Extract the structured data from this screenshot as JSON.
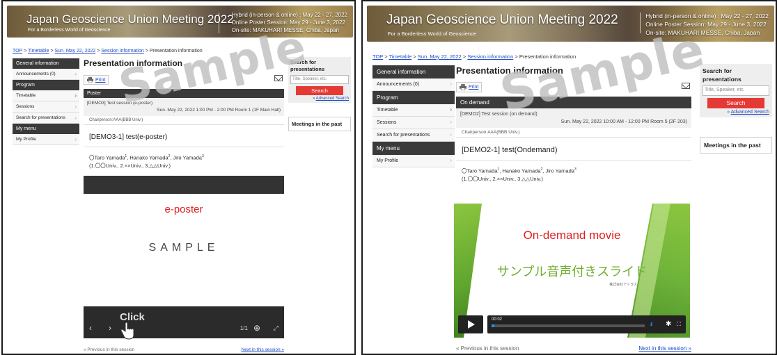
{
  "banner": {
    "title": "Japan Geoscience Union Meeting 2022",
    "tagline": "For a Borderless World of Geoscience",
    "info_line1": "Hybrid (in-person & online) : May 22 - 27, 2022",
    "info_line2": "Online Poster Session: May 29 - June 3, 2022",
    "info_line3": "On-site: MAKUHARI MESSE, Chiba, Japan"
  },
  "breadcrumb": {
    "top": "TOP",
    "timetable": "Timetable",
    "date": "Sun. May 22, 2022",
    "session_info": "Session information",
    "current": "Presentation information",
    "sep": ">"
  },
  "sidebar": {
    "general_info": "General information",
    "announcements": "Announcements (0)",
    "program": "Program",
    "timetable": "Timetable",
    "sessions": "Sessions",
    "search_presentations": "Search for presentations",
    "my_menu": "My menu",
    "my_profile": "My Profile",
    "chevron": "›"
  },
  "main": {
    "page_title": "Presentation information",
    "print": "Print"
  },
  "left": {
    "section": "Poster",
    "session": "[DEMO3] Test session (e-poster)",
    "datetime": "Sun. May 22, 2022 1:00 PM - 2:00 PM Room 1 (1F Main Hall)",
    "chair": "Chairperson:AAA(BBB Univ.)",
    "abstract_title": "[DEMO3-1] test(e-poster)",
    "viewer_title": "e-poster",
    "viewer_sample": "SAMPLE",
    "click_label": "Click",
    "page_indicator": "1/1",
    "prev_arrow": "‹",
    "next_arrow": "›"
  },
  "right": {
    "section": "On demand",
    "session": "[DEMO2] Test session (on demand)",
    "datetime": "Sun. May 22, 2022 10:00 AM - 12:00 PM Room 5 (2F 203)",
    "chair": "Chairperson:AAA(BBB Univ.)",
    "abstract_title": "[DEMO2-1] test(Ondemand)",
    "video_title": "On-demand movie",
    "video_subtitle": "サンプル音声付きスライド",
    "video_corp": "株式会社アトラス",
    "video_time": "00:02",
    "video_progress": 0.02
  },
  "authors": {
    "a1": "〇Taro Yamada",
    "a2": "Hanako Yamada",
    "a3": "Jiro Yamada",
    "sup1": "1",
    "sup2": "2",
    "sup3": "3",
    "sep": ", ",
    "affiliations": "(1.〇〇Univ., 2.××Univ., 3.△△Univ.)"
  },
  "search": {
    "label": "Search for presentations",
    "placeholder": "Title, Speaker, etc.",
    "button": "Search",
    "advanced": "Advanced Search",
    "advanced_prefix": "» "
  },
  "past_meetings": "Meetings in the past",
  "nav": {
    "prev": "« Previous in this session",
    "next": "Next in this session »"
  },
  "watermark": "Sample",
  "colors": {
    "accent_red": "#e53935",
    "dark_bar": "#3a3a3a",
    "link_blue": "#1a4bc4",
    "slide_green": "#8cc63f"
  },
  "icons": {
    "print": "printer-icon",
    "mail": "mail-icon",
    "zoom": "zoom-in-icon",
    "fullscreen": "fullscreen-icon",
    "play": "play-icon",
    "volume": "volume-icon",
    "settings": "gear-icon",
    "expand": "expand-icon",
    "hand": "pointer-hand-icon"
  }
}
